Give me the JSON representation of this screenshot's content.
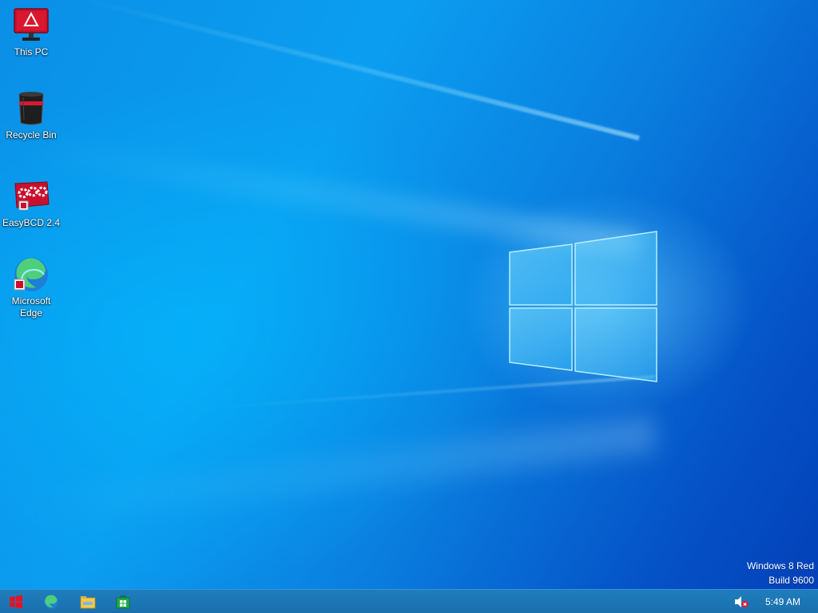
{
  "desktop": {
    "icons": [
      {
        "label": "This PC",
        "icon": "this-pc-icon"
      },
      {
        "label": "Recycle Bin",
        "icon": "recycle-bin-icon"
      },
      {
        "label": "EasyBCD 2.4",
        "icon": "easybcd-icon"
      },
      {
        "label": "Microsoft Edge",
        "icon": "edge-icon"
      }
    ],
    "watermark": {
      "line1": "Windows 8 Red",
      "line2": "Build 9600"
    }
  },
  "taskbar": {
    "buttons": [
      {
        "name": "start",
        "icon": "windows-start-icon"
      },
      {
        "name": "edge",
        "icon": "edge-icon"
      },
      {
        "name": "file-explorer",
        "icon": "folder-icon"
      },
      {
        "name": "store",
        "icon": "store-icon"
      }
    ],
    "tray": {
      "volume_icon": "volume-muted-icon",
      "clock": "5:49 AM"
    }
  },
  "colors": {
    "accent_red": "#c8102e",
    "taskbar": "#1b72b0",
    "wallpaper": "#0a8fe6"
  }
}
